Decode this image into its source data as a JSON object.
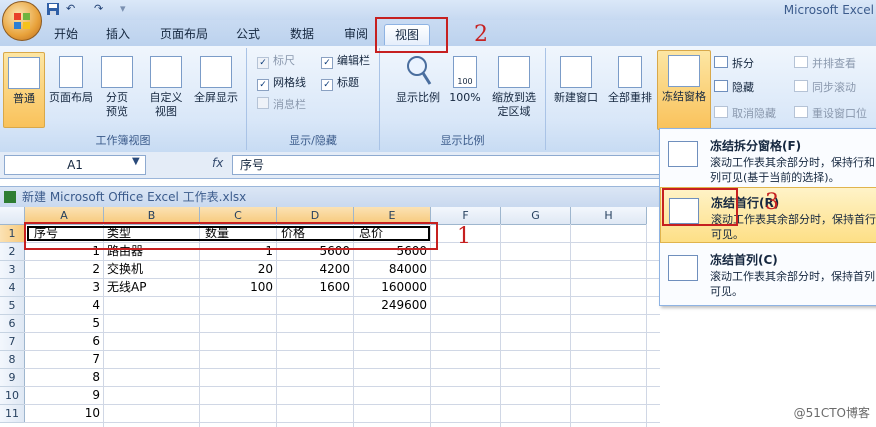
{
  "app_title": "Microsoft Excel",
  "quick_access": {
    "undo": "↶",
    "redo": "↷"
  },
  "tabs": [
    "开始",
    "插入",
    "页面布局",
    "公式",
    "数据",
    "审阅",
    "视图"
  ],
  "active_tab": "视图",
  "ribbon": {
    "workbook_views": {
      "label": "工作簿视图",
      "buttons": [
        "普通",
        "页面布局",
        "分页预览",
        "自定义视图",
        "全屏显示"
      ]
    },
    "show_hide": {
      "label": "显示/隐藏",
      "checks": [
        {
          "label": "标尺",
          "checked": true,
          "disabled": true
        },
        {
          "label": "编辑栏",
          "checked": true,
          "disabled": false
        },
        {
          "label": "网格线",
          "checked": true,
          "disabled": false
        },
        {
          "label": "标题",
          "checked": true,
          "disabled": false
        },
        {
          "label": "消息栏",
          "checked": false,
          "disabled": true
        }
      ]
    },
    "zoom": {
      "label": "显示比例",
      "buttons": [
        "显示比例",
        "100%",
        "缩放到选定区域"
      ],
      "icon_100": "100"
    },
    "window": {
      "buttons": [
        "新建窗口",
        "全部重排",
        "冻结窗格"
      ],
      "small": [
        {
          "label": "拆分",
          "disabled": false
        },
        {
          "label": "隐藏",
          "disabled": false
        },
        {
          "label": "取消隐藏",
          "disabled": true
        },
        {
          "label": "并排查看",
          "disabled": true
        },
        {
          "label": "同步滚动",
          "disabled": true
        },
        {
          "label": "重设窗口位",
          "disabled": true
        }
      ]
    }
  },
  "formula_bar": {
    "name_box": "A1",
    "fx": "fx",
    "content": "序号"
  },
  "workbook_title": "新建 Microsoft Office Excel 工作表.xlsx",
  "columns": [
    "A",
    "B",
    "C",
    "D",
    "E",
    "F",
    "G",
    "H"
  ],
  "rows": [
    [
      "序号",
      "类型",
      "数量",
      "价格",
      "总价"
    ],
    [
      "1",
      "路由器",
      "1",
      "5600",
      "5600"
    ],
    [
      "2",
      "交换机",
      "20",
      "4200",
      "84000"
    ],
    [
      "3",
      "无线AP",
      "100",
      "1600",
      "160000"
    ],
    [
      "4",
      "",
      "",
      "",
      "249600"
    ],
    [
      "5",
      "",
      "",
      "",
      ""
    ],
    [
      "6",
      "",
      "",
      "",
      ""
    ],
    [
      "7",
      "",
      "",
      "",
      ""
    ],
    [
      "8",
      "",
      "",
      "",
      ""
    ],
    [
      "9",
      "",
      "",
      "",
      ""
    ],
    [
      "10",
      "",
      "",
      "",
      ""
    ]
  ],
  "row_numbers": [
    "1",
    "2",
    "3",
    "4",
    "5",
    "6",
    "7",
    "8",
    "9",
    "10",
    "11"
  ],
  "freeze_menu": [
    {
      "title": "冻结拆分窗格(F)",
      "desc": "滚动工作表其余部分时，保持行和列可见(基于当前的选择)。"
    },
    {
      "title": "冻结首行(R)",
      "desc": "滚动工作表其余部分时，保持首行可见。"
    },
    {
      "title": "冻结首列(C)",
      "desc": "滚动工作表其余部分时，保持首列可见。"
    }
  ],
  "annotations": [
    "1",
    "2",
    "3"
  ],
  "watermark": "@51CTO博客"
}
